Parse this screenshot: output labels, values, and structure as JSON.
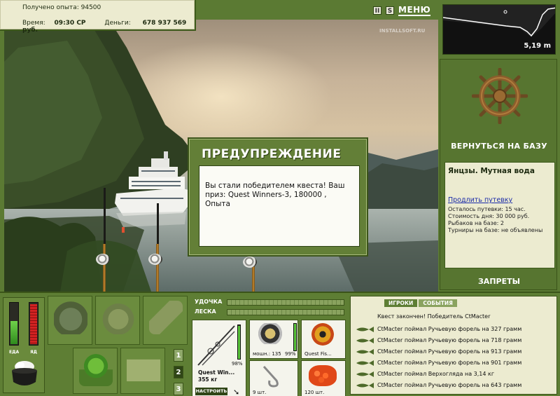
{
  "info": {
    "xp_label": "Получено опыта:",
    "xp_value": "94500",
    "time_label": "Время:",
    "time_value": "09:30 СР",
    "money_label": "Деньги:",
    "money_value": "678 937 569 руб."
  },
  "topbar": {
    "pause_label": "II",
    "sound_label": "S",
    "menu_label": "МЕНЮ"
  },
  "scene": {
    "watermark": "INSTALLSOFT.RU"
  },
  "dialog": {
    "title": "ПРЕДУПРЕЖДЕНИЕ",
    "message": "Вы стали победителем квеста! Ваш приз: Quest Winners-3, 180000 , Опыта"
  },
  "minimap": {
    "depth": "5,19 m"
  },
  "base": {
    "return_label": "ВЕРНУТЬСЯ НА БАЗУ",
    "name": "Янцзы. Мутная вода",
    "buy_link": "Продлить путевку",
    "remaining": "Осталось путевки: 15 час.",
    "cost": "Стоимость дня: 30 000 руб.",
    "anglers": "Рыбаков на базе: 2",
    "tournaments": "Турниры на базе: не объявлены",
    "bans_label": "ЗАПРЕТЫ"
  },
  "gauges": {
    "food_label": "ЕДА",
    "poison_label": "ЯД",
    "food_level": 0.55,
    "poison_level": 0.95
  },
  "slots": {
    "page_buttons": [
      "1",
      "2",
      "3"
    ]
  },
  "tackle": {
    "rod_label": "УДОЧКА",
    "line_label": "ЛЕСКА",
    "rod_name": "Quest Win...",
    "rod_weight": "355 кг",
    "rod_percent": "98%",
    "setup_label": "НАСТРОИТЬ",
    "reel_caption": "мошн.: 135",
    "reel_percent": "99%",
    "line_caption": "Quest Fis...",
    "hook_caption": "9 шт.",
    "bait_caption": "120 шт."
  },
  "events": {
    "tab_players": "ИГРОКИ",
    "tab_events": "СОБЫТИЯ",
    "header": "Квест закончен! Победитель CtMacter",
    "rows": [
      "CtMacter поймал Ручьевую форель на 327 грамм",
      "CtMacter поймал Ручьевую форель на 718 грамм",
      "CtMacter поймал Ручьевую форель на 913 грамм",
      "CtMacter поймал Ручьевую форель на 901 грамм",
      "CtMacter поймал Верхогляда на 3,14 кг",
      "CtMacter поймал Ручьевую форель на 643 грамм"
    ]
  },
  "colors": {
    "panel_green": "#5e7e34",
    "panel_cream": "#ecebd0",
    "link_blue": "#1a2aa8"
  }
}
